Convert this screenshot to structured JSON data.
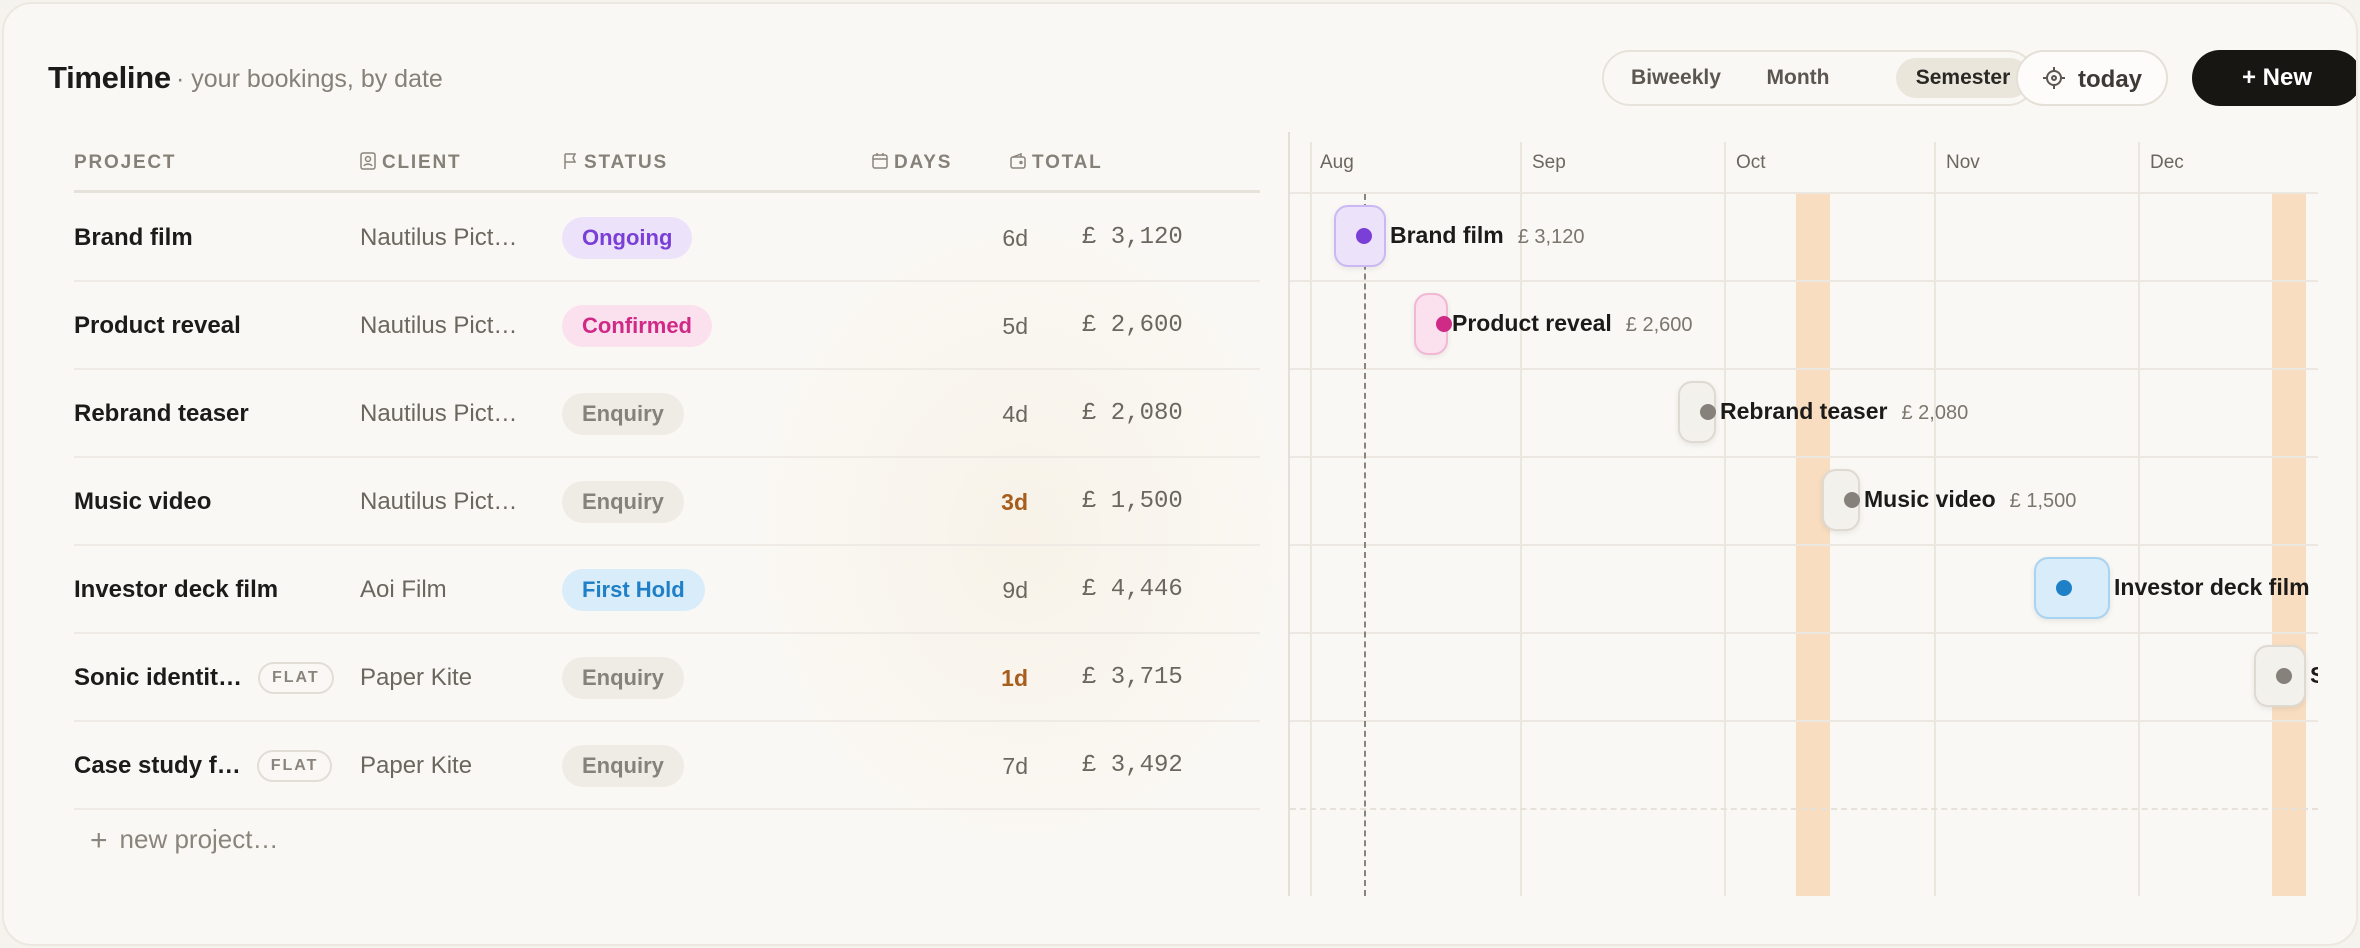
{
  "header": {
    "title": "Timeline",
    "subtitle": "· your bookings, by date",
    "views": [
      "Biweekly",
      "Month",
      "Semester"
    ],
    "active_view": "Semester",
    "today_label": "today",
    "new_label": "+ New"
  },
  "table": {
    "columns": [
      "PROJECT",
      "CLIENT",
      "STATUS",
      "DAYS",
      "TOTAL"
    ],
    "rows": [
      {
        "project": "Brand film",
        "flat": "",
        "client": "Nautilus Pict…",
        "status": "Ongoing",
        "days": "6d",
        "total": "£ 3,120"
      },
      {
        "project": "Product reveal",
        "flat": "",
        "client": "Nautilus Pict…",
        "status": "Confirmed",
        "days": "5d",
        "total": "£ 2,600"
      },
      {
        "project": "Rebrand teaser",
        "flat": "",
        "client": "Nautilus Pict…",
        "status": "Enquiry",
        "days": "4d",
        "total": "£ 2,080"
      },
      {
        "project": "Music video",
        "flat": "",
        "client": "Nautilus Pict…",
        "status": "Enquiry",
        "days": "3d",
        "total": "£ 1,500"
      },
      {
        "project": "Investor deck film",
        "flat": "",
        "client": "Aoi Film",
        "status": "First Hold",
        "days": "9d",
        "total": "£ 4,446"
      },
      {
        "project": "Sonic identit…",
        "flat": "FLAT",
        "client": "Paper Kite",
        "status": "Enquiry",
        "days": "1d",
        "total": "£ 3,715"
      },
      {
        "project": "Case study f…",
        "flat": "FLAT",
        "client": "Paper Kite",
        "status": "Enquiry",
        "days": "7d",
        "total": "£ 3,492"
      }
    ],
    "new_project_label": "new project…"
  },
  "status_colors": {
    "Ongoing": {
      "bg": "#ece3fb",
      "fg": "#7a3fd6"
    },
    "Confirmed": {
      "bg": "#fbe0ee",
      "fg": "#cf2a86"
    },
    "Enquiry": {
      "bg": "#efece6",
      "fg": "#86817a"
    },
    "First Hold": {
      "bg": "#d8ecfa",
      "fg": "#1f80c7"
    }
  },
  "timeline": {
    "months": [
      "Aug",
      "Sep",
      "Oct",
      "Nov",
      "Dec"
    ],
    "bars": [
      {
        "label": "Brand film",
        "amount": "£ 3,120",
        "status": "Ongoing"
      },
      {
        "label": "Product reveal",
        "amount": "£ 2,600",
        "status": "Confirmed"
      },
      {
        "label": "Rebrand teaser",
        "amount": "£ 2,080",
        "status": "Enquiry"
      },
      {
        "label": "Music video",
        "amount": "£ 1,500",
        "status": "Enquiry"
      },
      {
        "label": "Investor deck film",
        "amount": "£",
        "status": "First Hold"
      },
      {
        "label": "S",
        "amount": "",
        "status": "Enquiry"
      }
    ]
  }
}
